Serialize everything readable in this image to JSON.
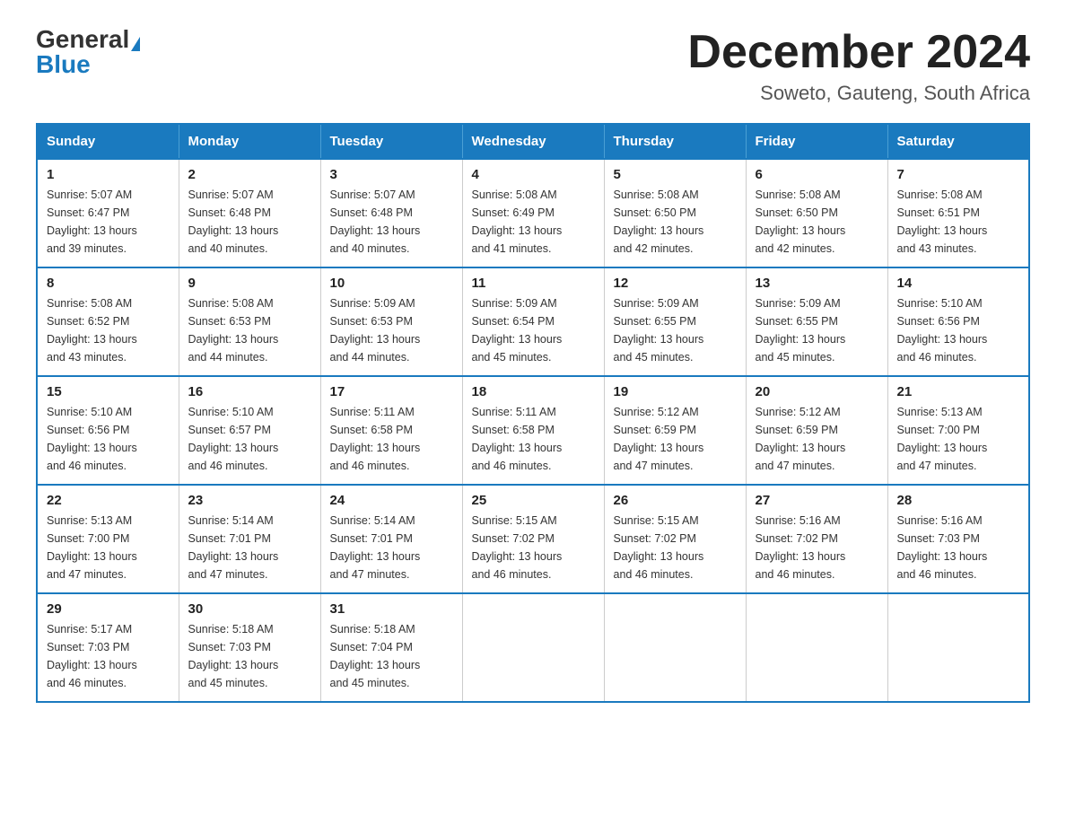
{
  "header": {
    "logo_general": "General",
    "logo_blue": "Blue",
    "month_title": "December 2024",
    "subtitle": "Soweto, Gauteng, South Africa"
  },
  "weekdays": [
    "Sunday",
    "Monday",
    "Tuesday",
    "Wednesday",
    "Thursday",
    "Friday",
    "Saturday"
  ],
  "weeks": [
    [
      {
        "day": "1",
        "sunrise": "5:07 AM",
        "sunset": "6:47 PM",
        "daylight": "13 hours and 39 minutes."
      },
      {
        "day": "2",
        "sunrise": "5:07 AM",
        "sunset": "6:48 PM",
        "daylight": "13 hours and 40 minutes."
      },
      {
        "day": "3",
        "sunrise": "5:07 AM",
        "sunset": "6:48 PM",
        "daylight": "13 hours and 40 minutes."
      },
      {
        "day": "4",
        "sunrise": "5:08 AM",
        "sunset": "6:49 PM",
        "daylight": "13 hours and 41 minutes."
      },
      {
        "day": "5",
        "sunrise": "5:08 AM",
        "sunset": "6:50 PM",
        "daylight": "13 hours and 42 minutes."
      },
      {
        "day": "6",
        "sunrise": "5:08 AM",
        "sunset": "6:50 PM",
        "daylight": "13 hours and 42 minutes."
      },
      {
        "day": "7",
        "sunrise": "5:08 AM",
        "sunset": "6:51 PM",
        "daylight": "13 hours and 43 minutes."
      }
    ],
    [
      {
        "day": "8",
        "sunrise": "5:08 AM",
        "sunset": "6:52 PM",
        "daylight": "13 hours and 43 minutes."
      },
      {
        "day": "9",
        "sunrise": "5:08 AM",
        "sunset": "6:53 PM",
        "daylight": "13 hours and 44 minutes."
      },
      {
        "day": "10",
        "sunrise": "5:09 AM",
        "sunset": "6:53 PM",
        "daylight": "13 hours and 44 minutes."
      },
      {
        "day": "11",
        "sunrise": "5:09 AM",
        "sunset": "6:54 PM",
        "daylight": "13 hours and 45 minutes."
      },
      {
        "day": "12",
        "sunrise": "5:09 AM",
        "sunset": "6:55 PM",
        "daylight": "13 hours and 45 minutes."
      },
      {
        "day": "13",
        "sunrise": "5:09 AM",
        "sunset": "6:55 PM",
        "daylight": "13 hours and 45 minutes."
      },
      {
        "day": "14",
        "sunrise": "5:10 AM",
        "sunset": "6:56 PM",
        "daylight": "13 hours and 46 minutes."
      }
    ],
    [
      {
        "day": "15",
        "sunrise": "5:10 AM",
        "sunset": "6:56 PM",
        "daylight": "13 hours and 46 minutes."
      },
      {
        "day": "16",
        "sunrise": "5:10 AM",
        "sunset": "6:57 PM",
        "daylight": "13 hours and 46 minutes."
      },
      {
        "day": "17",
        "sunrise": "5:11 AM",
        "sunset": "6:58 PM",
        "daylight": "13 hours and 46 minutes."
      },
      {
        "day": "18",
        "sunrise": "5:11 AM",
        "sunset": "6:58 PM",
        "daylight": "13 hours and 46 minutes."
      },
      {
        "day": "19",
        "sunrise": "5:12 AM",
        "sunset": "6:59 PM",
        "daylight": "13 hours and 47 minutes."
      },
      {
        "day": "20",
        "sunrise": "5:12 AM",
        "sunset": "6:59 PM",
        "daylight": "13 hours and 47 minutes."
      },
      {
        "day": "21",
        "sunrise": "5:13 AM",
        "sunset": "7:00 PM",
        "daylight": "13 hours and 47 minutes."
      }
    ],
    [
      {
        "day": "22",
        "sunrise": "5:13 AM",
        "sunset": "7:00 PM",
        "daylight": "13 hours and 47 minutes."
      },
      {
        "day": "23",
        "sunrise": "5:14 AM",
        "sunset": "7:01 PM",
        "daylight": "13 hours and 47 minutes."
      },
      {
        "day": "24",
        "sunrise": "5:14 AM",
        "sunset": "7:01 PM",
        "daylight": "13 hours and 47 minutes."
      },
      {
        "day": "25",
        "sunrise": "5:15 AM",
        "sunset": "7:02 PM",
        "daylight": "13 hours and 46 minutes."
      },
      {
        "day": "26",
        "sunrise": "5:15 AM",
        "sunset": "7:02 PM",
        "daylight": "13 hours and 46 minutes."
      },
      {
        "day": "27",
        "sunrise": "5:16 AM",
        "sunset": "7:02 PM",
        "daylight": "13 hours and 46 minutes."
      },
      {
        "day": "28",
        "sunrise": "5:16 AM",
        "sunset": "7:03 PM",
        "daylight": "13 hours and 46 minutes."
      }
    ],
    [
      {
        "day": "29",
        "sunrise": "5:17 AM",
        "sunset": "7:03 PM",
        "daylight": "13 hours and 46 minutes."
      },
      {
        "day": "30",
        "sunrise": "5:18 AM",
        "sunset": "7:03 PM",
        "daylight": "13 hours and 45 minutes."
      },
      {
        "day": "31",
        "sunrise": "5:18 AM",
        "sunset": "7:04 PM",
        "daylight": "13 hours and 45 minutes."
      },
      null,
      null,
      null,
      null
    ]
  ],
  "labels": {
    "sunrise": "Sunrise:",
    "sunset": "Sunset:",
    "daylight": "Daylight:"
  }
}
